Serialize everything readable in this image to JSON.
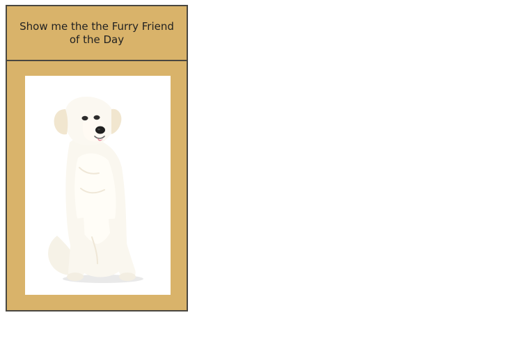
{
  "card": {
    "title": "Show me the the Furry Friend\nof the Day"
  },
  "photo": {
    "subject": "white dog sitting",
    "background_color": "#ffffff"
  },
  "colors": {
    "card_background": "#d9b36a",
    "border": "#4a4740",
    "text": "#222222"
  }
}
